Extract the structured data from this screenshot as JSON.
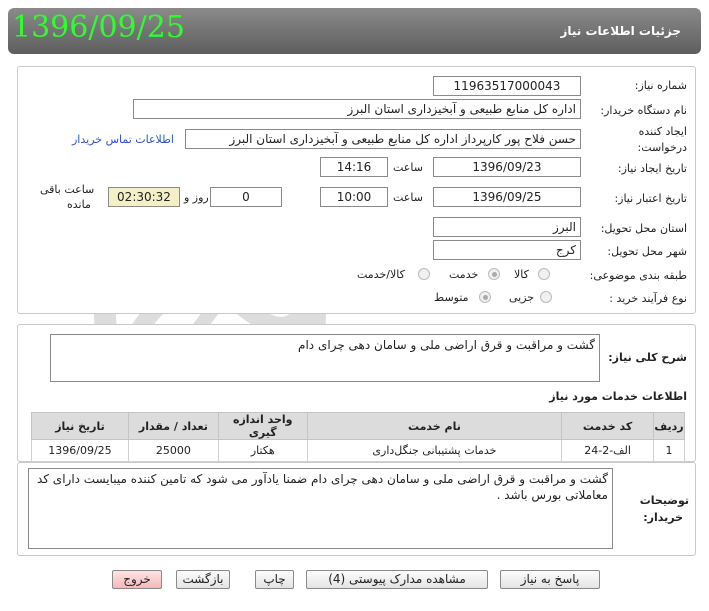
{
  "header": {
    "title": "جزئیات اطلاعات نیاز",
    "date": "1396/09/25"
  },
  "form": {
    "need_number_label": "شماره نیاز:",
    "need_number": "11963517000043",
    "buyer_label": "نام دستگاه خریدار:",
    "buyer": "اداره کل منابع طبیعی و آبخیزداری استان البرز",
    "creator_label_line1": "ایجاد کننده",
    "creator_label_line2": "درخواست:",
    "creator": "حسن فلاح پور کارپرداز اداره کل منابع طبیعی و آبخیزداری استان البرز",
    "contact_link": "اطلاعات تماس خریدار",
    "created_label": "تاریخ ایجاد نیاز:",
    "created_date": "1396/09/23",
    "time_label": "ساعت",
    "created_time": "14:16",
    "validity_label": "تاریخ اعتبار نیاز:",
    "validity_date": "1396/09/25",
    "validity_time": "10:00",
    "days_value": "0",
    "days_label": "روز و",
    "remaining": "02:30:32",
    "remaining_label_line1": "ساعت باقی",
    "remaining_label_line2": "مانده",
    "province_label": "استان محل تحویل:",
    "province": "البرز",
    "city_label": "شهر محل تحویل:",
    "city": "کرج",
    "category_label": "طبقه بندی موضوعی:",
    "category_options": [
      "کالا",
      "خدمت",
      "کالا/خدمت"
    ],
    "category_selected": "خدمت",
    "process_label": "نوع فرآیند خرید :",
    "process_options": [
      "جزیی",
      "متوسط"
    ],
    "process_selected": "متوسط"
  },
  "summary": {
    "label": "شرح کلی نیاز:",
    "text": "گشت و مراقبت و قرق اراضی ملی و سامان دهی چرای دام"
  },
  "services": {
    "title": "اطلاعات خدمات مورد نیاز",
    "columns": [
      "ردیف",
      "کد خدمت",
      "نام خدمت",
      "واحد اندازه گیری",
      "تعداد / مقدار",
      "تاریخ نیاز"
    ],
    "rows": [
      [
        "1",
        "الف-2-24",
        "خدمات پشتیبانی جنگل‌داری",
        "هکتار",
        "25000",
        "1396/09/25"
      ]
    ]
  },
  "notes": {
    "label_line1": "توضیحات",
    "label_line2": "خریدار:",
    "text": "گشت و مراقبت و قرق اراضی ملی و سامان دهی چرای دام ضمنا یادآور می شود که تامین کننده میبایست دارای کد معاملاتی بورس باشد ."
  },
  "buttons": {
    "respond": "پاسخ به نیاز",
    "attachments": "مشاهده مدارک پیوستی (4)",
    "print": "چاپ",
    "back": "بازگشت",
    "exit": "خروج"
  },
  "colors": {
    "date_green": "#2cff2c",
    "link_blue": "#2a54c8",
    "header_gray": "#6e6e6e"
  }
}
